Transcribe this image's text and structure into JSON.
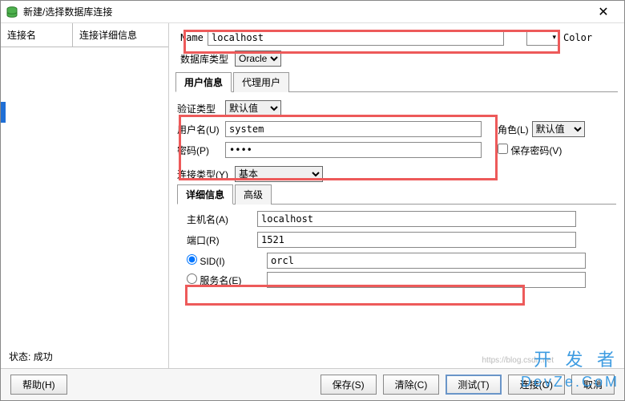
{
  "window": {
    "title": "新建/选择数据库连接",
    "close": "✕"
  },
  "left": {
    "col_name": "连接名",
    "col_detail": "连接详细信息"
  },
  "form": {
    "name_label": "Name",
    "name_value": "localhost",
    "color_label": "Color",
    "dbtype_label": "数据库类型",
    "dbtype_value": "Oracle",
    "tab_user": "用户信息",
    "tab_proxy": "代理用户",
    "auth_label": "验证类型",
    "auth_value": "默认值",
    "username_label": "用户名(U)",
    "username_value": "system",
    "password_label": "密码(P)",
    "password_value": "••••",
    "role_label": "角色(L)",
    "role_value": "默认值",
    "savepwd_label": "保存密码(V)",
    "conntype_label": "连接类型(Y)",
    "conntype_value": "基本",
    "subtab_detail": "详细信息",
    "subtab_adv": "高级",
    "host_label": "主机名(A)",
    "host_value": "localhost",
    "port_label": "端口(R)",
    "port_value": "1521",
    "sid_label": "SID(I)",
    "sid_value": "orcl",
    "svc_label": "服务名(E)"
  },
  "status": {
    "label": "状态:",
    "value": "成功"
  },
  "buttons": {
    "help": "帮助(H)",
    "save": "保存(S)",
    "clear": "清除(C)",
    "test": "测试(T)",
    "connect": "连接(O)",
    "cancel": "取消"
  },
  "watermark": {
    "line1": "开 发 者",
    "line2": "DevZe.CoM",
    "url": "https://blog.csdn.net"
  }
}
